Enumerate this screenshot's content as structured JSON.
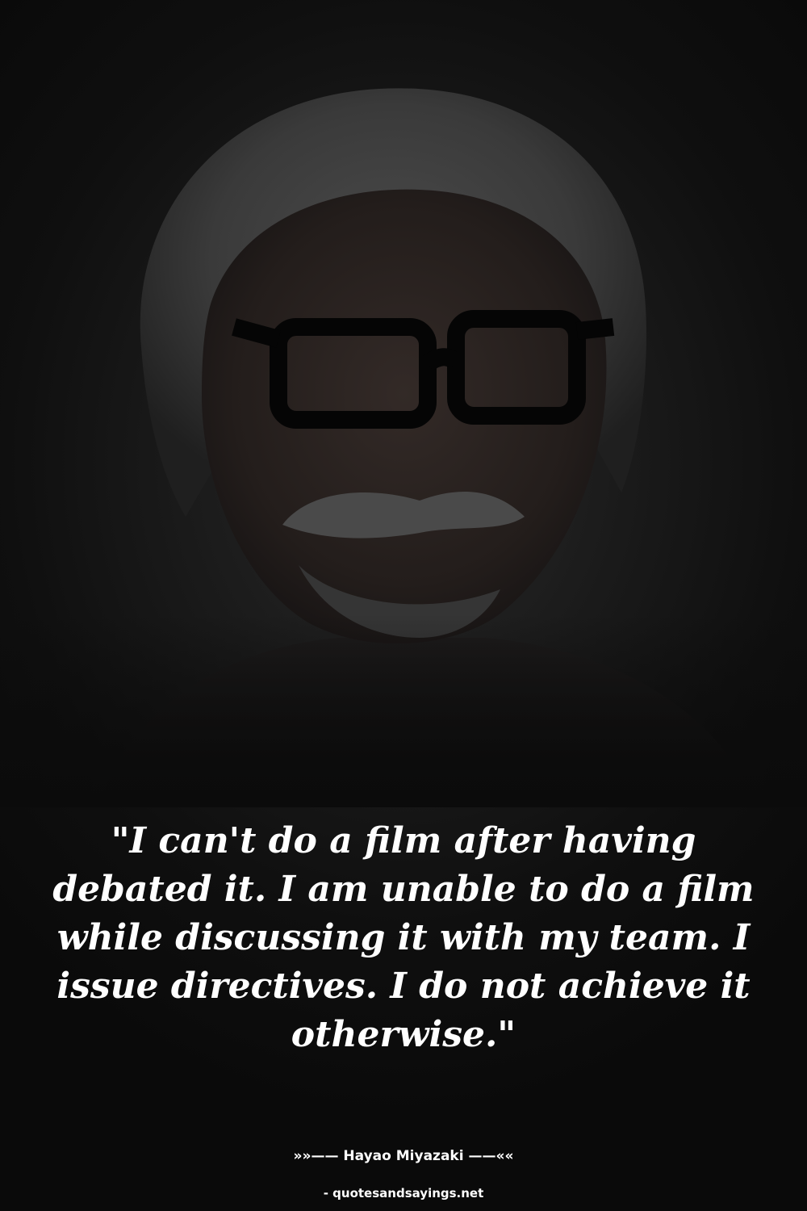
{
  "quote": {
    "text": "\"I can't do a film after having debated it. I am unable to do a film while discussing it with my team. I issue directives. I do not achieve it otherwise.\"",
    "author_line": "»»—— Hayao Miyazaki ——««"
  },
  "footer": {
    "source": "- quotesandsayings.net"
  },
  "colors": {
    "background": "#0b0b0b",
    "text": "#ffffff"
  }
}
